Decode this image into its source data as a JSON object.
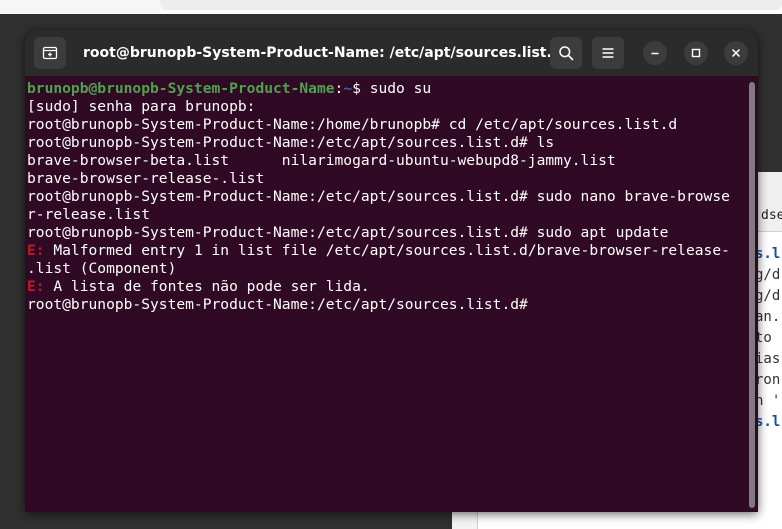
{
  "window": {
    "title": "root@brunopb-System-Product-Name: /etc/apt/sources.list.d"
  },
  "icons": {
    "new_tab": "new-tab-icon",
    "search": "search-icon",
    "menu": "hamburger-menu-icon",
    "minimize": "minimize-icon",
    "maximize": "maximize-icon",
    "close": "close-icon"
  },
  "colors": {
    "terminal_bg": "#300a24",
    "titlebar_bg": "#2b2b2b",
    "prompt_user": "#4ea24e",
    "prompt_path": "#3465a4",
    "error": "#c01c28"
  },
  "terminal": {
    "line1": {
      "user_host": "brunopb@brunopb-System-Product-Name",
      "colon": ":",
      "path": "~",
      "command": "$ sudo su"
    },
    "line2": "[sudo] senha para brunopb:",
    "line3": "root@brunopb-System-Product-Name:/home/brunopb# cd /etc/apt/sources.list.d",
    "line4": "root@brunopb-System-Product-Name:/etc/apt/sources.list.d# ls",
    "line5": "brave-browser-beta.list      nilarimogard-ubuntu-webupd8-jammy.list",
    "line6": "brave-browser-release-.list",
    "line7": "root@brunopb-System-Product-Name:/etc/apt/sources.list.d# sudo nano brave-browse",
    "line8": "r-release.list",
    "line9": "root@brunopb-System-Product-Name:/etc/apt/sources.list.d# sudo apt update",
    "line10": {
      "tag": "E:",
      "text": " Malformed entry 1 in list file /etc/apt/sources.list.d/brave-browser-release-"
    },
    "line11": ".list (Component)",
    "line12": {
      "tag": "E:",
      "text": " A lista de fontes não pode ser lida."
    },
    "line13": "root@brunopb-System-Product-Name:/etc/apt/sources.list.d#"
  },
  "background_doc": {
    "tab_fragment": "dse",
    "lines": [
      {
        "text": "s.l",
        "blue": true
      },
      {
        "text": "g/d",
        "blue": false
      },
      {
        "text": "g/d",
        "blue": false
      },
      {
        "text": "an.",
        "blue": false
      },
      {
        "text": "to ",
        "blue": false
      },
      {
        "text": "ias",
        "blue": false
      },
      {
        "text": "ron",
        "blue": false
      },
      {
        "text": "n '",
        "blue": false
      },
      {
        "text": "s.l",
        "blue": true
      }
    ]
  }
}
